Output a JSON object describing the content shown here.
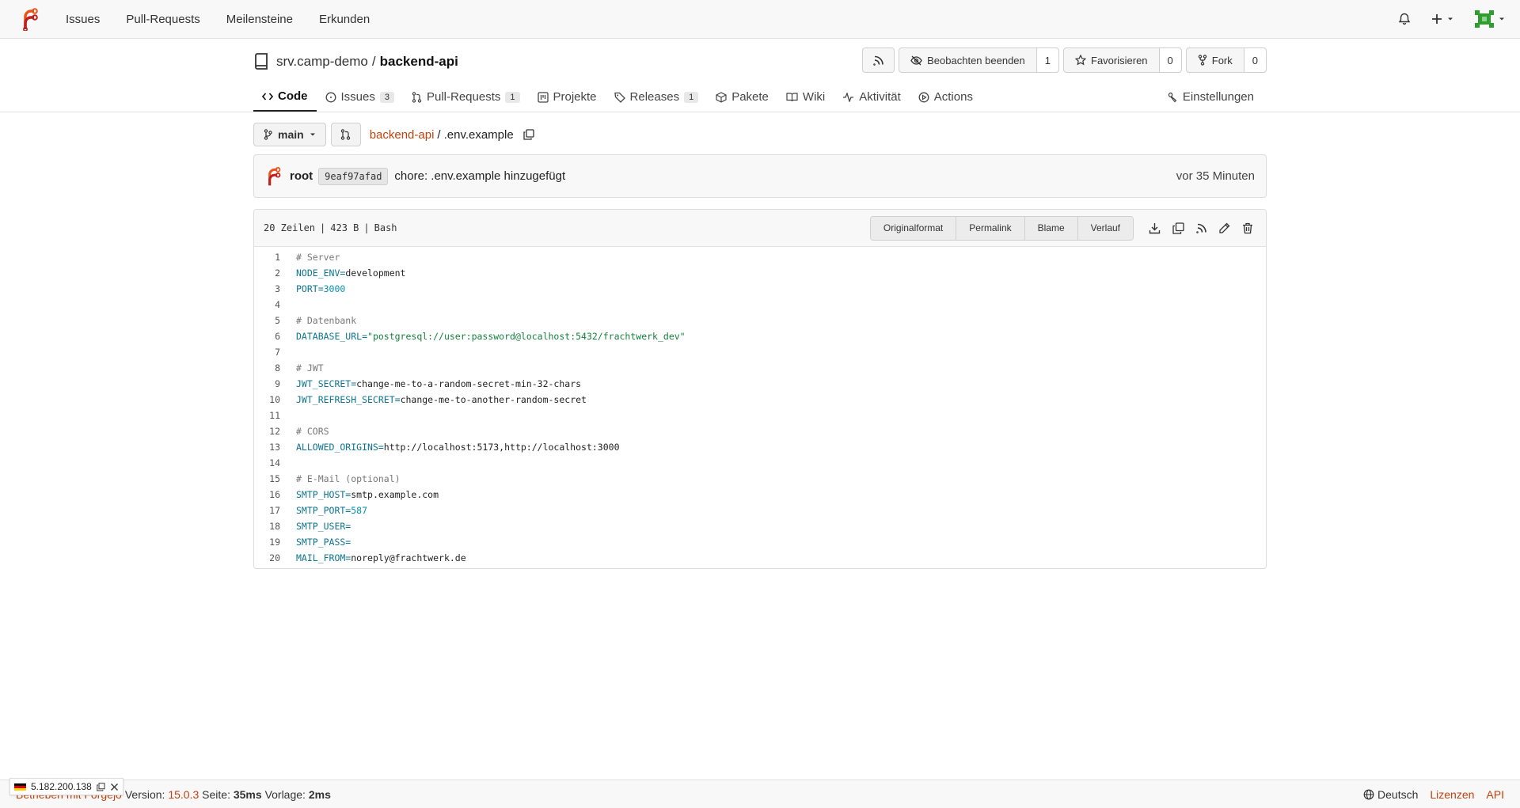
{
  "nav": {
    "items": [
      "Issues",
      "Pull-Requests",
      "Meilensteine",
      "Erkunden"
    ]
  },
  "repo": {
    "owner": "srv.camp-demo",
    "separator": "/",
    "name": "backend-api",
    "watch_label": "Beobachten beenden",
    "watch_count": "1",
    "star_label": "Favorisieren",
    "star_count": "0",
    "fork_label": "Fork",
    "fork_count": "0"
  },
  "tabs": {
    "code": "Code",
    "issues": "Issues",
    "issues_count": "3",
    "pulls": "Pull-Requests",
    "pulls_count": "1",
    "projects": "Projekte",
    "releases": "Releases",
    "releases_count": "1",
    "packages": "Pakete",
    "wiki": "Wiki",
    "activity": "Aktivität",
    "actions": "Actions",
    "settings": "Einstellungen"
  },
  "path": {
    "branch": "main",
    "root": "backend-api",
    "sep": "/",
    "file": ".env.example"
  },
  "commit": {
    "author": "root",
    "sha": "9eaf97afad",
    "message": "chore: .env.example hinzugefügt",
    "time": "vor 35 Minuten"
  },
  "file": {
    "lines": "20 Zeilen",
    "size": "423 B",
    "lang": "Bash",
    "buttons": [
      "Originalformat",
      "Permalink",
      "Blame",
      "Verlauf"
    ]
  },
  "code_lines": [
    {
      "n": "1",
      "parts": [
        [
          "c-comment",
          "# Server"
        ]
      ]
    },
    {
      "n": "2",
      "parts": [
        [
          "c-key",
          "NODE_ENV="
        ],
        [
          "",
          "development"
        ]
      ]
    },
    {
      "n": "3",
      "parts": [
        [
          "c-key",
          "PORT="
        ],
        [
          "c-num",
          "3000"
        ]
      ]
    },
    {
      "n": "4",
      "parts": []
    },
    {
      "n": "5",
      "parts": [
        [
          "c-comment",
          "# Datenbank"
        ]
      ]
    },
    {
      "n": "6",
      "parts": [
        [
          "c-key",
          "DATABASE_URL="
        ],
        [
          "c-str",
          "\"postgresql://user:password@localhost:5432/frachtwerk_dev\""
        ]
      ]
    },
    {
      "n": "7",
      "parts": []
    },
    {
      "n": "8",
      "parts": [
        [
          "c-comment",
          "# JWT"
        ]
      ]
    },
    {
      "n": "9",
      "parts": [
        [
          "c-key",
          "JWT_SECRET="
        ],
        [
          "",
          "change-me-to-a-random-secret-min-32-chars"
        ]
      ]
    },
    {
      "n": "10",
      "parts": [
        [
          "c-key",
          "JWT_REFRESH_SECRET="
        ],
        [
          "",
          "change-me-to-another-random-secret"
        ]
      ]
    },
    {
      "n": "11",
      "parts": []
    },
    {
      "n": "12",
      "parts": [
        [
          "c-comment",
          "# CORS"
        ]
      ]
    },
    {
      "n": "13",
      "parts": [
        [
          "c-key",
          "ALLOWED_ORIGINS="
        ],
        [
          "",
          "http://localhost:5173,http://localhost:3000"
        ]
      ]
    },
    {
      "n": "14",
      "parts": []
    },
    {
      "n": "15",
      "parts": [
        [
          "c-comment",
          "# E-Mail (optional)"
        ]
      ]
    },
    {
      "n": "16",
      "parts": [
        [
          "c-key",
          "SMTP_HOST="
        ],
        [
          "",
          "smtp.example.com"
        ]
      ]
    },
    {
      "n": "17",
      "parts": [
        [
          "c-key",
          "SMTP_PORT="
        ],
        [
          "c-num",
          "587"
        ]
      ]
    },
    {
      "n": "18",
      "parts": [
        [
          "c-key",
          "SMTP_USER="
        ]
      ]
    },
    {
      "n": "19",
      "parts": [
        [
          "c-key",
          "SMTP_PASS="
        ]
      ]
    },
    {
      "n": "20",
      "parts": [
        [
          "c-key",
          "MAIL_FROM="
        ],
        [
          "",
          "noreply@frachtwerk.de"
        ]
      ]
    }
  ],
  "footer": {
    "powered": "Betrieben mit Forgejo",
    "version_label": "Version:",
    "version": "15.0.3",
    "page_label": "Seite:",
    "page_time": "35ms",
    "template_label": "Vorlage:",
    "template_time": "2ms",
    "language": "Deutsch",
    "licenses": "Lizenzen",
    "api": "API",
    "ip": "5.182.200.138"
  },
  "colors": {
    "accent": "#c2410c",
    "avatar": "#2e9f2e"
  }
}
